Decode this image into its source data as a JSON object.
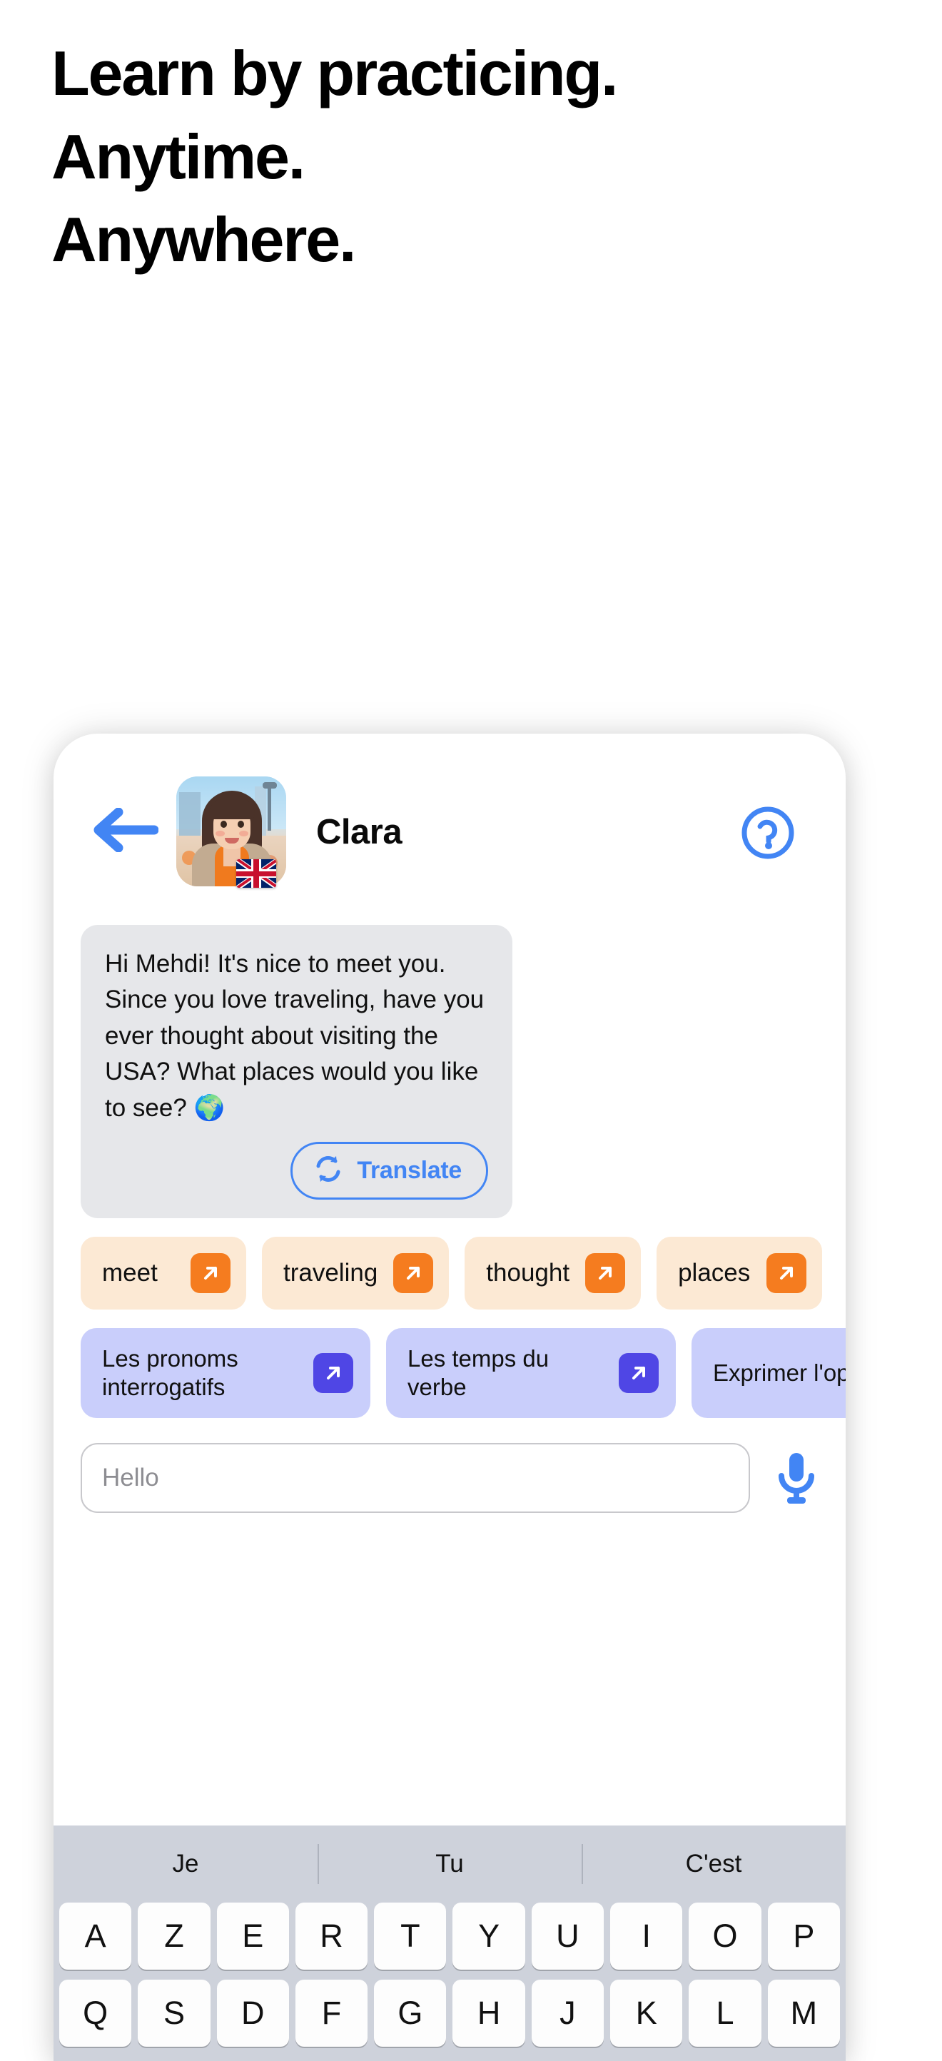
{
  "headline": {
    "lines": [
      "Learn by practicing.",
      "Anytime.",
      "Anywhere."
    ]
  },
  "phone": {
    "chat_header": {
      "back_icon": "back-arrow-icon",
      "avatar_alt": "clara-avatar",
      "flag": "uk-flag",
      "contact_name": "Clara",
      "help_icon": "help-circle-icon"
    },
    "message": {
      "text": "Hi Mehdi! It's nice to meet you. Since you love traveling, have you ever thought about visiting the USA? What places would you like to see? 🌍",
      "translate_label": "Translate",
      "translate_icon": "refresh-icon"
    },
    "vocab_chips": [
      {
        "label": "meet",
        "icon": "arrow-up-right-icon"
      },
      {
        "label": "traveling",
        "icon": "arrow-up-right-icon"
      },
      {
        "label": "thought",
        "icon": "arrow-up-right-icon"
      },
      {
        "label": "places",
        "icon": "arrow-up-right-icon"
      }
    ],
    "grammar_chips": [
      {
        "label": "Les pronoms interrogatifs",
        "icon": "arrow-up-right-icon"
      },
      {
        "label": "Les temps du verbe",
        "icon": "arrow-up-right-icon"
      },
      {
        "label": "Exprimer l'opinion",
        "icon": "arrow-up-right-icon"
      }
    ],
    "input": {
      "value": "",
      "placeholder": "Hello",
      "mic_icon": "microphone-icon"
    },
    "keyboard": {
      "suggestions": [
        "Je",
        "Tu",
        "C'est"
      ],
      "row1": [
        "A",
        "Z",
        "E",
        "R",
        "T",
        "Y",
        "U",
        "I",
        "O",
        "P"
      ],
      "row2": [
        "Q",
        "S",
        "D",
        "F",
        "G",
        "H",
        "J",
        "K",
        "L",
        "M"
      ]
    }
  },
  "colors": {
    "accent_blue": "#4285f4",
    "bubble_bg": "#e6e7ea",
    "vocab_chip_bg": "#fce9d4",
    "vocab_badge": "#f57c1f",
    "grammar_chip_bg": "#c9cefb",
    "grammar_badge": "#4f46e5",
    "keyboard_bg": "#ced2db",
    "page_bg": "#ffffff"
  }
}
